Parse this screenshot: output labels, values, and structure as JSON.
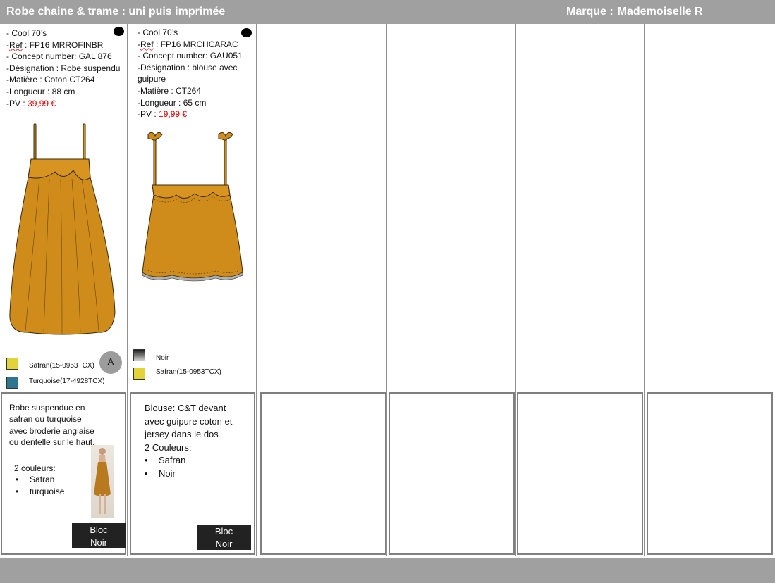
{
  "header": {
    "title": "Robe chaine & trame : uni puis imprimée",
    "brand_label": "Marque :",
    "brand_name": "Mademoiselle R"
  },
  "products": [
    {
      "theme": "- Cool 70’s",
      "ref_prefix": "-",
      "ref_label": "Ref",
      "ref_value": " : FP16 MRROFINBR",
      "concept": "- Concept number: GAL 876",
      "designation": "-Désignation : Robe suspendu",
      "matiere": "-Matière : Coton CT264",
      "longueur": "-Longueur : 88 cm",
      "pv_label": "-PV : ",
      "pv_value": "39,99 €",
      "colors": [
        {
          "name": "Safran(15-0953TCX)",
          "hex": "#e2d33b"
        },
        {
          "name": "Turquoise(17-4928TCX)",
          "hex": "#2f7590"
        }
      ],
      "badge": "A",
      "description": "Robe suspendue en safran ou turquoise avec broderie anglaise ou dentelle sur le haut.",
      "colors_title": "2 couleurs:",
      "bullets": [
        "Safran",
        "turquoise"
      ],
      "bloc_line1": "Bloc",
      "bloc_line2": "Noir",
      "garment_color": "#cf8c1b"
    },
    {
      "theme": "- Cool 70’s",
      "ref_prefix": "-",
      "ref_label": "Ref",
      "ref_value": " : FP16 MRCHCARAC",
      "concept": "- Concept number: GAU051",
      "designation_1": "-Désignation : blouse avec",
      "designation_2": "guipure",
      "matiere": "-Matière : CT264",
      "longueur": "-Longueur : 65 cm",
      "pv_label": "-PV : ",
      "pv_value": " 19,99 €",
      "colors": [
        {
          "name": "Noir",
          "hex": "#1e1e1e"
        },
        {
          "name": "Safran(15-0953TCX)",
          "hex": "#e2d33b"
        }
      ],
      "description_1": "Blouse: C&T devant avec guipure coton et jersey dans le dos",
      "colors_title": "2 Couleurs:",
      "bullets": [
        "Safran",
        "Noir"
      ],
      "bloc_line1": "Bloc",
      "bloc_line2": "Noir",
      "garment_color": "#cf8c1b"
    }
  ]
}
